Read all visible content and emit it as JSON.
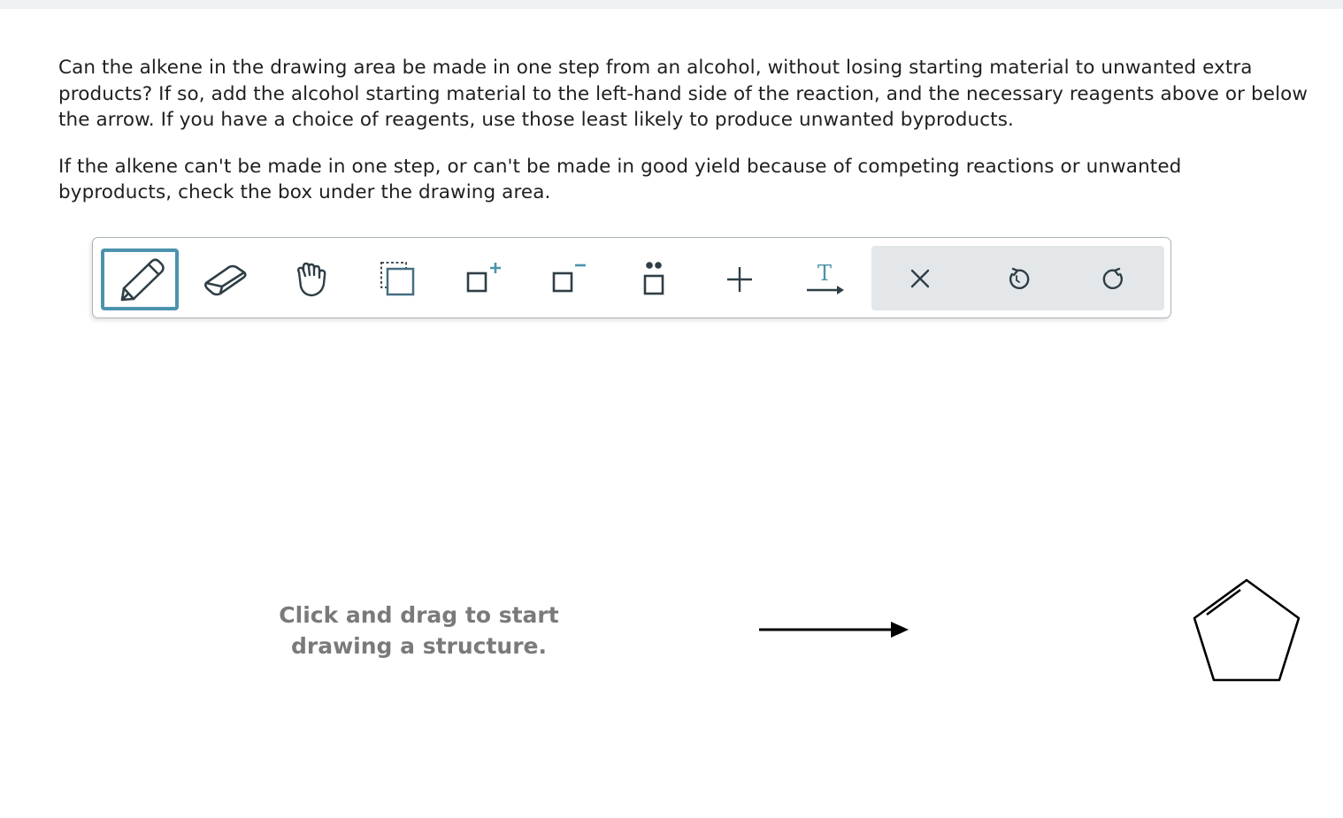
{
  "question": {
    "paragraph1": "Can the alkene in the drawing area be made in one step from an alcohol, without losing starting material to unwanted extra products? If so, add the alcohol starting material to the left-hand side of the reaction, and the necessary reagents above or below the arrow. If you have a choice of reagents, use those least likely to produce unwanted byproducts.",
    "paragraph2": "If the alkene can't be made in one step, or can't be made in good yield because of competing reactions or unwanted byproducts, check the box under the drawing area."
  },
  "toolbar": {
    "tools": [
      {
        "icon": "pencil-icon",
        "selected": true
      },
      {
        "icon": "eraser-icon",
        "selected": false
      },
      {
        "icon": "hand-icon",
        "selected": false
      },
      {
        "icon": "select-box-icon",
        "selected": false
      },
      {
        "icon": "positive-charge-icon",
        "selected": false,
        "glyph": "+"
      },
      {
        "icon": "negative-charge-icon",
        "selected": false,
        "glyph": "−"
      },
      {
        "icon": "lone-pair-icon",
        "selected": false
      },
      {
        "icon": "plus-icon",
        "selected": false,
        "glyph": "+"
      },
      {
        "icon": "text-arrow-icon",
        "selected": false,
        "glyph": "T"
      }
    ],
    "actions": [
      {
        "icon": "clear-x-icon"
      },
      {
        "icon": "undo-icon"
      },
      {
        "icon": "redo-icon"
      }
    ],
    "accent_color": "#4b93ad",
    "action_bg": "#e3e7ea"
  },
  "canvas": {
    "hint": "Click and drag to start\ndrawing a structure.",
    "product": "cyclopentene"
  }
}
